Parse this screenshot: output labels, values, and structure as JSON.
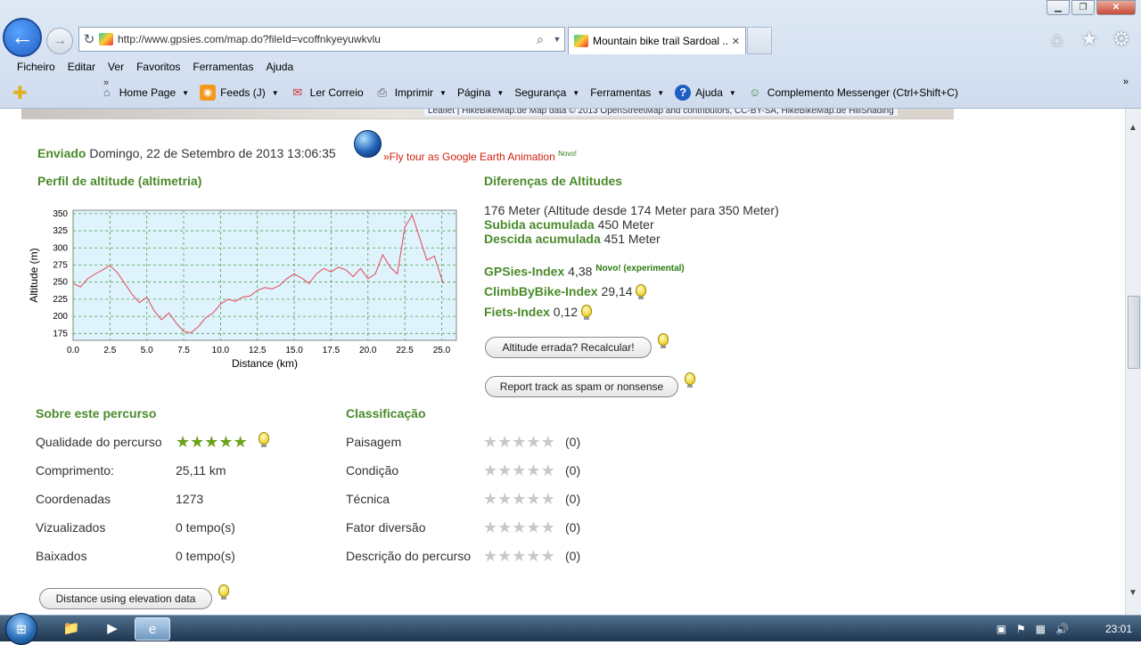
{
  "browser": {
    "url": "http://www.gpsies.com/map.do?fileId=vcoffnkyeyuwkvlu",
    "tab_title": "Mountain bike trail Sardoal ...",
    "menu": [
      "Ficheiro",
      "Editar",
      "Ver",
      "Favoritos",
      "Ferramentas",
      "Ajuda"
    ],
    "commands": [
      {
        "label": "Home Page",
        "icon": "home-icon",
        "dropdown": true
      },
      {
        "label": "Feeds (J)",
        "icon": "rss-icon",
        "dropdown": true
      },
      {
        "label": "Ler Correio",
        "icon": "mail-icon",
        "dropdown": false
      },
      {
        "label": "Imprimir",
        "icon": "printer-icon",
        "dropdown": true
      },
      {
        "label": "Página",
        "icon": "",
        "dropdown": true
      },
      {
        "label": "Segurança",
        "icon": "",
        "dropdown": true
      },
      {
        "label": "Ferramentas",
        "icon": "",
        "dropdown": true
      },
      {
        "label": "Ajuda",
        "icon": "help-icon",
        "dropdown": true
      },
      {
        "label": "Complemento Messenger (Ctrl+Shift+C)",
        "icon": "messenger-icon",
        "dropdown": false
      }
    ]
  },
  "map_attribution": "Leaflet | HikeBikeMap.de Map data © 2013 OpenStreetMap and contributors, CC-BY-SA, HikeBikeMap.de HillShading",
  "sent": {
    "label": "Enviado",
    "date": "Domingo, 22 de Setembro de 2013 13:06:35"
  },
  "flytour": {
    "label": "»Fly tour as Google Earth Animation",
    "new": "Novo!"
  },
  "profile_title": "Perfil de altitude (altimetria)",
  "chart_data": {
    "type": "line",
    "xlabel": "Distance (km)",
    "ylabel": "Altitude (m)",
    "xlim": [
      0,
      26
    ],
    "ylim": [
      165,
      355
    ],
    "xticks": [
      "0.0",
      "2.5",
      "5.0",
      "7.5",
      "10.0",
      "12.5",
      "15.0",
      "17.5",
      "20.0",
      "22.5",
      "25.0"
    ],
    "yticks": [
      "175",
      "200",
      "225",
      "250",
      "275",
      "300",
      "325",
      "350"
    ],
    "grid": true,
    "x": [
      0,
      0.5,
      1,
      1.5,
      2,
      2.5,
      3,
      3.5,
      4,
      4.5,
      5,
      5.5,
      6,
      6.5,
      7,
      7.5,
      8,
      8.5,
      9,
      9.5,
      10,
      10.5,
      11,
      11.5,
      12,
      12.5,
      13,
      13.5,
      14,
      14.5,
      15,
      15.5,
      16,
      16.5,
      17,
      17.5,
      18,
      18.5,
      19,
      19.5,
      20,
      20.5,
      21,
      21.5,
      22,
      22.5,
      23,
      23.5,
      24,
      24.5,
      25,
      25.1
    ],
    "y": [
      248,
      243,
      255,
      262,
      268,
      274,
      264,
      248,
      232,
      220,
      228,
      208,
      195,
      205,
      190,
      178,
      176,
      185,
      198,
      205,
      218,
      225,
      222,
      228,
      230,
      238,
      242,
      240,
      245,
      255,
      262,
      256,
      248,
      262,
      270,
      265,
      272,
      268,
      258,
      270,
      255,
      262,
      290,
      272,
      262,
      330,
      348,
      315,
      282,
      288,
      255,
      248
    ]
  },
  "altitudes": {
    "title": "Diferenças de Altitudes",
    "diff": "176 Meter (Altitude desde 174 Meter para 350 Meter)",
    "climb_label": "Subida acumulada",
    "climb_value": "450 Meter",
    "descent_label": "Descida acumulada",
    "descent_value": "451 Meter",
    "gpsies_label": "GPSies-Index",
    "gpsies_value": "4,38",
    "gpsies_new": "Novo! (experimental)",
    "climbbybike_label": "ClimbByBike-Index",
    "climbbybike_value": "29,14",
    "fiets_label": "Fiets-Index",
    "fiets_value": "0,12",
    "recalc_button": "Altitude errada? Recalcular!",
    "spam_button": "Report track as spam or nonsense"
  },
  "about": {
    "title": "Sobre este percurso",
    "quality_label": "Qualidade do percurso",
    "quality_stars": 5,
    "length_label": "Comprimento:",
    "length_value": "25,11 km",
    "coords_label": "Coordenadas",
    "coords_value": "1273",
    "views_label": "Vizualizados",
    "views_value": "0 tempo(s)",
    "downloads_label": "Baixados",
    "downloads_value": "0 tempo(s)",
    "distance_button": "Distance using elevation data"
  },
  "rating": {
    "title": "Classificação",
    "items": [
      {
        "label": "Paisagem",
        "stars": 0,
        "count": "(0)"
      },
      {
        "label": "Condição",
        "stars": 0,
        "count": "(0)"
      },
      {
        "label": "Técnica",
        "stars": 0,
        "count": "(0)"
      },
      {
        "label": "Fator diversão",
        "stars": 0,
        "count": "(0)"
      },
      {
        "label": "Descrição do percurso",
        "stars": 0,
        "count": "(0)"
      }
    ]
  },
  "taskbar": {
    "clock": "23:01"
  },
  "colors": {
    "green": "#4a8a2a",
    "chart_line": "#e8455a",
    "chart_bg": "#def3fb",
    "link_red": "#d02010"
  }
}
